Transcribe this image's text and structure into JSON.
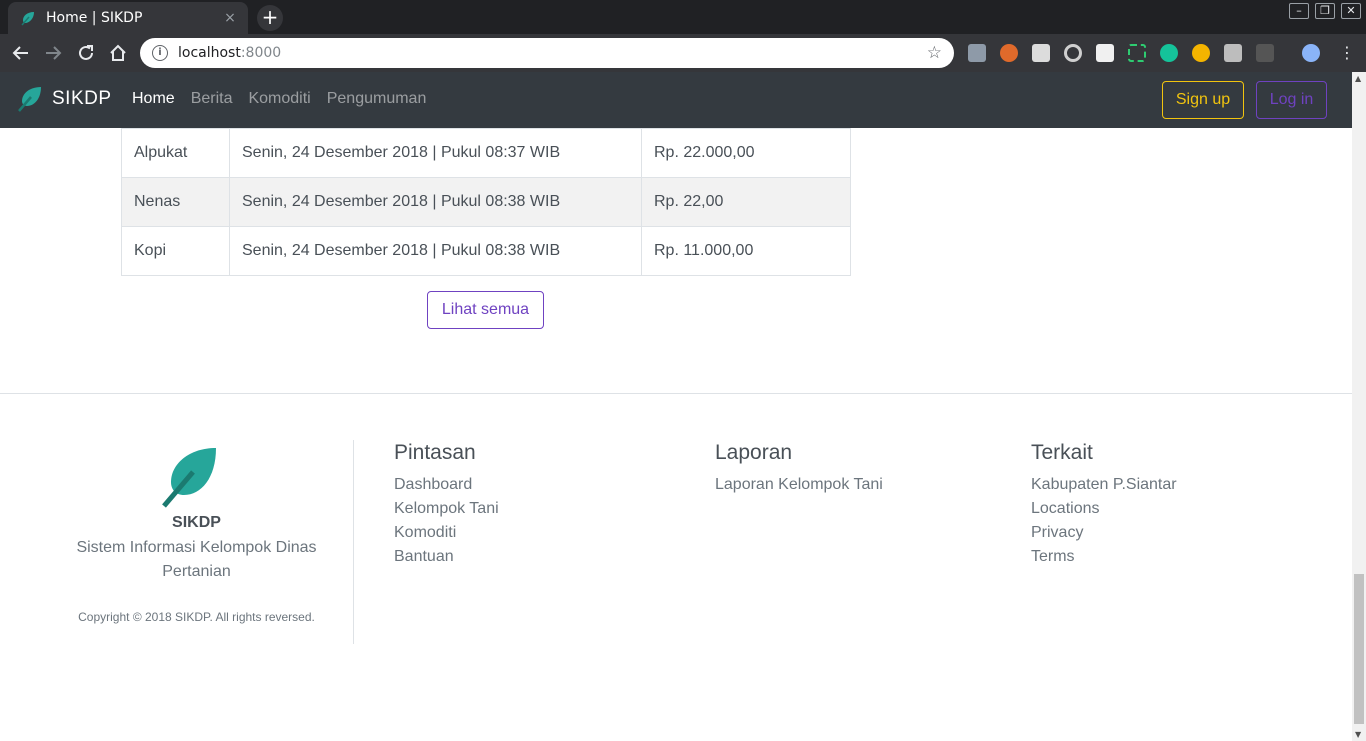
{
  "browser": {
    "tab_title": "Home | SIKDP",
    "tab_close": "×",
    "new_tab": "+",
    "url_host": "localhost",
    "url_port": ":8000",
    "window_controls": [
      "–",
      "❐",
      "✕"
    ]
  },
  "navbar": {
    "brand": "SIKDP",
    "links": [
      {
        "label": "Home",
        "active": true
      },
      {
        "label": "Berita",
        "active": false
      },
      {
        "label": "Komoditi",
        "active": false
      },
      {
        "label": "Pengumuman",
        "active": false
      }
    ],
    "signup_label": "Sign up",
    "login_label": "Log in"
  },
  "table": {
    "rows": [
      {
        "name": "Alpukat",
        "date": "Senin, 24 Desember 2018 | Pukul 08:37 WIB",
        "price": "Rp. 22.000,00"
      },
      {
        "name": "Nenas",
        "date": "Senin, 24 Desember 2018 | Pukul 08:38 WIB",
        "price": "Rp. 22,00"
      },
      {
        "name": "Kopi",
        "date": "Senin, 24 Desember 2018 | Pukul 08:38 WIB",
        "price": "Rp. 11.000,00"
      }
    ],
    "see_all_label": "Lihat semua"
  },
  "footer": {
    "brand": "SIKDP",
    "tagline": "Sistem Informasi Kelompok Dinas Pertanian",
    "copyright": "Copyright © 2018 SIKDP. All rights reversed.",
    "columns": [
      {
        "title": "Pintasan",
        "links": [
          "Dashboard",
          "Kelompok Tani",
          "Komoditi",
          "Bantuan"
        ]
      },
      {
        "title": "Laporan",
        "links": [
          "Laporan Kelompok Tani"
        ]
      },
      {
        "title": "Terkait",
        "links": [
          "Kabupaten P.Siantar",
          "Locations",
          "Privacy",
          "Terms"
        ]
      }
    ]
  },
  "colors": {
    "brand_leaf": "#26a69a",
    "navbar_bg": "#343a40",
    "signup": "#f1c40f",
    "login": "#6f42c1"
  }
}
